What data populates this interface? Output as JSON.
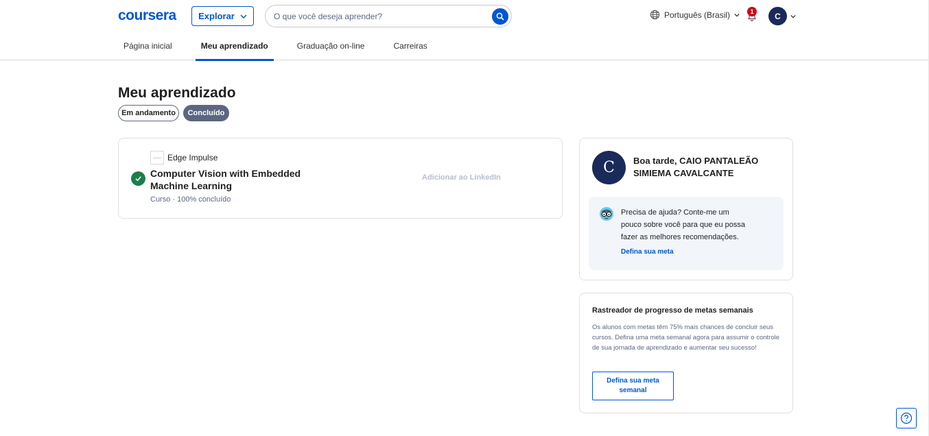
{
  "header": {
    "logo": "coursera",
    "explore_label": "Explorar",
    "search_placeholder": "O que você deseja aprender?",
    "language": "Português (Brasil)",
    "notification_count": "1",
    "avatar_initial": "C"
  },
  "nav": {
    "tabs": [
      {
        "label": "Página inicial",
        "active": false
      },
      {
        "label": "Meu aprendizado",
        "active": true
      },
      {
        "label": "Graduação on-line",
        "active": false
      },
      {
        "label": "Carreiras",
        "active": false
      }
    ]
  },
  "main": {
    "title": "Meu aprendizado",
    "filters": [
      {
        "label": "Em andamento",
        "selected": false
      },
      {
        "label": "Concluído",
        "selected": true
      }
    ],
    "course": {
      "partner": "Edge Impulse",
      "title": "Computer Vision with Embedded Machine Learning",
      "meta": "Curso · 100% concluído",
      "linkedin_label": "Adicionar ao LinkedIn",
      "status_color": "#1a7f4b"
    }
  },
  "sidebar": {
    "avatar_initial": "C",
    "greeting": "Boa tarde, CAIO PANTALEÃO SIMIEMA CAVALCANTE",
    "help_text": "Precisa de ajuda? Conte-me um pouco sobre você para que eu possa fazer as melhores recomendações.",
    "help_link": "Defina sua meta",
    "tracker": {
      "title": "Rastreador de progresso de metas semanais",
      "description": "Os alunos com metas têm 75% mais chances de concluir seus cursos. Defina uma meta semanal agora para assumir o controle de sua jornada de aprendizado e aumentar seu sucesso!",
      "button_label": "Defina sua meta semanal"
    }
  },
  "colors": {
    "brand": "#0056d2",
    "avatar": "#1a2a5a",
    "badge": "#d0021b",
    "chip_selected": "#5b6780"
  }
}
